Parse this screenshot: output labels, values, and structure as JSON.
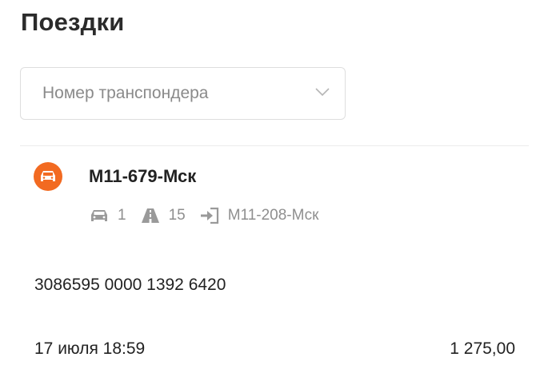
{
  "page": {
    "title": "Поездки"
  },
  "filter": {
    "transponder_placeholder": "Номер транспондера"
  },
  "trip": {
    "icon": "car-icon",
    "title": "М11-679-Мск",
    "vehicle_class": "1",
    "section": "15",
    "entry_point": "М11-208-Мск",
    "transponder_number": "3086595 0000 1392 6420",
    "datetime": "17 июля 18:59",
    "amount": "1 275,00"
  },
  "colors": {
    "accent": "#f26a21",
    "meta": "#8f8f8f",
    "text": "#222222"
  }
}
